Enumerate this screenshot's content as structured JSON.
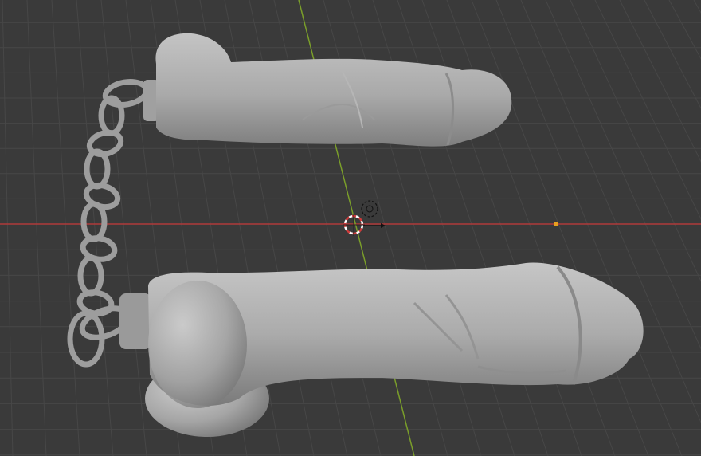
{
  "app": "3D viewport",
  "viewport": {
    "background": "#3a3a3a",
    "grid_color": "#474747",
    "x_axis_color": "#b03a3a",
    "y_axis_color": "#7a9e2a"
  },
  "scene_objects": [
    {
      "name": "model-upper",
      "kind": "mesh",
      "color": "#a8a8a8"
    },
    {
      "name": "model-lower",
      "kind": "mesh",
      "color": "#a8a8a8"
    },
    {
      "name": "chain",
      "kind": "mesh",
      "color": "#a8a8a8"
    }
  ],
  "markers": {
    "cursor_3d": "3d-cursor-icon",
    "camera": "camera-icon",
    "light": "light-point-icon",
    "light_color": "#e8a020"
  }
}
